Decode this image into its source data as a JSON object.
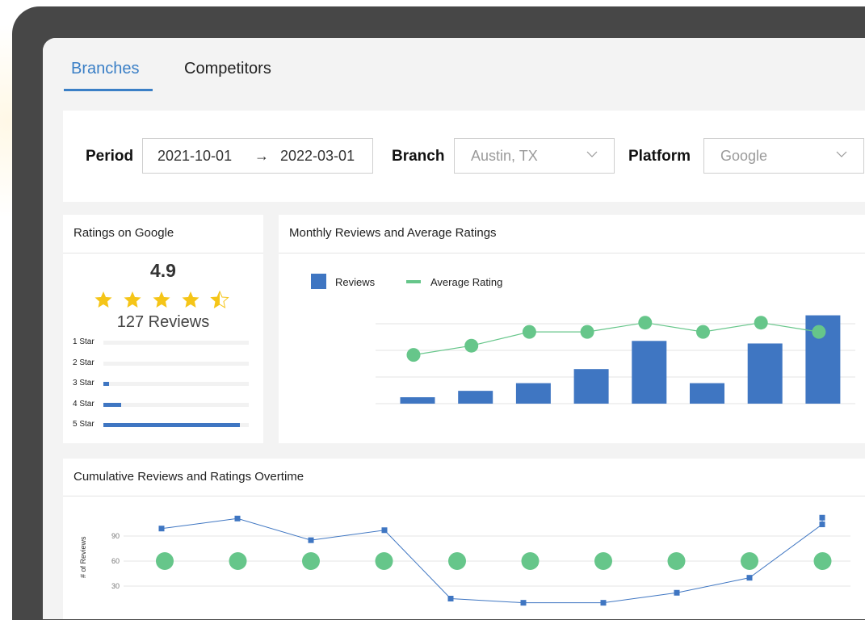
{
  "tabs": [
    {
      "label": "Branches",
      "active": true
    },
    {
      "label": "Competitors",
      "active": false
    }
  ],
  "filters": {
    "period_label": "Period",
    "period_start": "2021-10-01",
    "period_arrow": "→",
    "period_end": "2022-03-01",
    "branch_label": "Branch",
    "branch_value": "Austin, TX",
    "platform_label": "Platform",
    "platform_value": "Google"
  },
  "ratings_panel": {
    "title": "Ratings on Google",
    "average": "4.9",
    "stars": 4.5,
    "review_count": "127 Reviews",
    "distribution": [
      {
        "label": "1 Star",
        "fraction": 0.0
      },
      {
        "label": "2 Star",
        "fraction": 0.0
      },
      {
        "label": "3 Star",
        "fraction": 0.04
      },
      {
        "label": "4 Star",
        "fraction": 0.12
      },
      {
        "label": "5 Star",
        "fraction": 0.94
      }
    ]
  },
  "monthly_panel": {
    "title": "Monthly Reviews and Average Ratings",
    "legend": [
      {
        "label": "Reviews",
        "color": "#3f76c2"
      },
      {
        "label": "Average Rating",
        "color": "#66c68a"
      }
    ]
  },
  "cumulative_panel": {
    "title": "Cumulative Reviews and Ratings Overtime",
    "y_axis_title": "# of Reviews"
  },
  "chart_data": [
    {
      "type": "bar",
      "title": "Monthly Reviews and Average Ratings",
      "series": [
        {
          "name": "Reviews",
          "type": "bar",
          "values": [
            5,
            10,
            16,
            27,
            49,
            16,
            47,
            69
          ]
        },
        {
          "name": "Average Rating",
          "type": "line",
          "values": [
            4.2,
            4.4,
            4.7,
            4.7,
            4.9,
            4.7,
            4.9,
            4.7
          ]
        }
      ],
      "ylim": [
        0,
        70
      ],
      "grid": true,
      "legend": "top-left",
      "colors": {
        "Reviews": "#3f76c2",
        "Average Rating": "#66c68a"
      }
    },
    {
      "type": "line",
      "title": "Cumulative Reviews and Ratings Overtime",
      "ylabel": "# of Reviews",
      "yticks": [
        90,
        60,
        30
      ],
      "ylim": [
        20,
        115
      ],
      "series": [
        {
          "name": "Reviews",
          "type": "line",
          "values": [
            99,
            111,
            85,
            97,
            15,
            10,
            10,
            22,
            40,
            104,
            112
          ]
        },
        {
          "name": "Rating",
          "type": "scatter",
          "values": [
            60,
            60,
            60,
            60,
            60,
            60,
            60,
            60,
            60,
            60
          ]
        }
      ],
      "grid": true,
      "colors": {
        "Reviews": "#3f76c2",
        "Rating": "#66c68a"
      }
    }
  ]
}
